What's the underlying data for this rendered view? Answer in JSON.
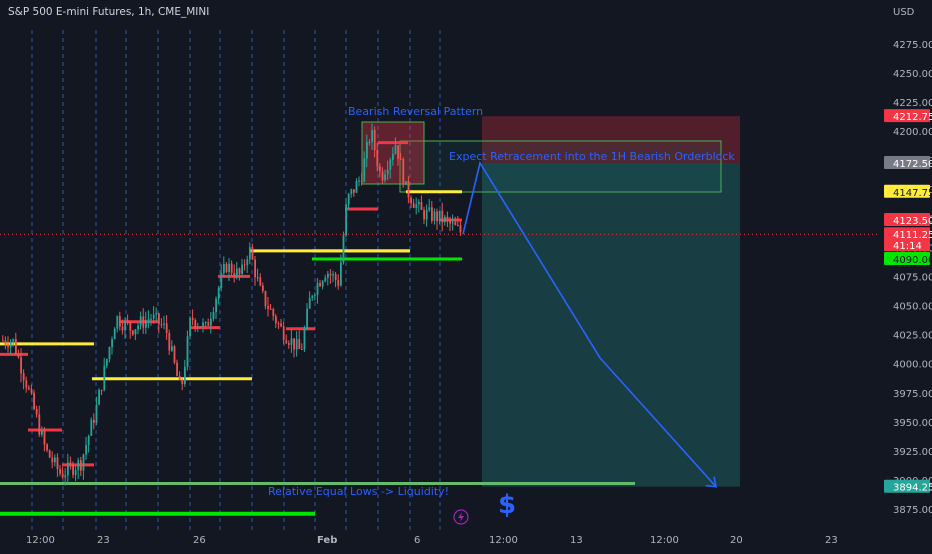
{
  "title": "S&P 500 E-mini Futures, 1h, CME_MINI",
  "currency": "USD",
  "chart_data": {
    "type": "candlestick",
    "y_ticks": [
      3875,
      3900,
      3925,
      3950,
      3975,
      4000,
      4025,
      4050,
      4075,
      4100,
      4125,
      4150,
      4175,
      4200,
      4225,
      4250,
      4275
    ],
    "y_tick_labels": [
      "3875.00",
      "3900.00",
      "3925.00",
      "3950.00",
      "3975.00",
      "4000.00",
      "4025.00",
      "4050.00",
      "4075.00",
      "4100.00",
      "4125.00",
      "4150.00",
      "4175.00",
      "4200.00",
      "4225.00",
      "4250.00",
      "4275.00"
    ],
    "ylim": [
      3867,
      4300
    ],
    "x_tick_labels": [
      "12:00",
      "23",
      "26",
      "Feb",
      "6",
      "12:00",
      "13",
      "12:00",
      "20",
      "23"
    ],
    "price_tags": [
      {
        "label": "4212.75",
        "value": 4212.75,
        "bg": "#f23645",
        "fg": "#ffffff"
      },
      {
        "label": "4172.50",
        "value": 4172.5,
        "bg": "#787b86",
        "fg": "#ffffff"
      },
      {
        "label": "4147.75",
        "value": 4147.75,
        "bg": "#ffeb3b",
        "fg": "#131722"
      },
      {
        "label": "4123.50",
        "value": 4123.5,
        "bg": "#f23645",
        "fg": "#ffffff"
      },
      {
        "label": "4111.25",
        "value": 4111.25,
        "bg": "#f23645",
        "fg": "#ffffff",
        "sub": "41:14"
      },
      {
        "label": "4090.00",
        "value": 4090.0,
        "bg": "#00e600",
        "fg": "#131722"
      },
      {
        "label": "3894.25",
        "value": 3894.25,
        "bg": "#26a69a",
        "fg": "#ffffff"
      }
    ],
    "annotations": {
      "pattern": "Bearish Reversal Pattern",
      "retracement": "Expect Retracement into the 1H Bearish Orderblock",
      "lows": "Relative Equal Lows -> Liquidity!",
      "dollar": "$"
    },
    "last_price": 4111.25,
    "entry": 4172.5,
    "stop": 4212.75,
    "target": 3894.25,
    "projection": [
      {
        "label": "from",
        "value": 4111.25
      },
      {
        "label": "retrace",
        "value": 4172.5
      },
      {
        "label": "mid",
        "value": 4005
      },
      {
        "label": "target",
        "value": 3894.25
      }
    ],
    "levels": {
      "yellow": [
        4017,
        3987,
        4097,
        4097,
        4147.75
      ],
      "red": [
        4008,
        3943,
        3913,
        4036,
        4031,
        4075,
        4030,
        4133,
        4190,
        4123.5
      ],
      "green": [
        4090,
        3897,
        3871
      ]
    },
    "colors": {
      "up": "#26a69a",
      "down": "#ef5350",
      "background": "#131722",
      "grid_dash": "#2a6fd6",
      "yellow": "#ffeb3b",
      "red": "#f23645",
      "green": "#00e600",
      "blue": "#2962ff"
    }
  }
}
